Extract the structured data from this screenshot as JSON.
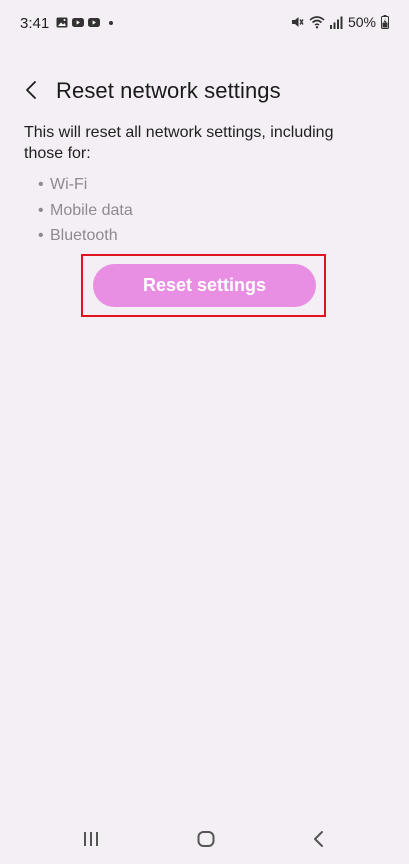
{
  "status_bar": {
    "time": "3:41",
    "battery": "50%",
    "icons_left": [
      "gallery-icon",
      "youtube-icon",
      "youtube-icon",
      "dot"
    ],
    "icons_right": [
      "mute-icon",
      "wifi-icon",
      "signal-icon",
      "battery-icon"
    ]
  },
  "header": {
    "title": "Reset network settings",
    "back_icon": "chevron-left-icon"
  },
  "content": {
    "description": "This will reset all network settings, including those for:",
    "items": [
      {
        "label": "Wi-Fi"
      },
      {
        "label": "Mobile data"
      },
      {
        "label": "Bluetooth"
      }
    ],
    "bullet": "•"
  },
  "actions": {
    "reset_label": "Reset settings",
    "reset_color": "#e98fe3",
    "highlight_color": "#e0141e"
  },
  "nav_bar": {
    "buttons": [
      "recents-icon",
      "home-icon",
      "back-icon"
    ]
  },
  "colors": {
    "background": "#f4eef5",
    "text_primary": "#1f1f1f",
    "text_secondary": "#8e8a8f"
  }
}
